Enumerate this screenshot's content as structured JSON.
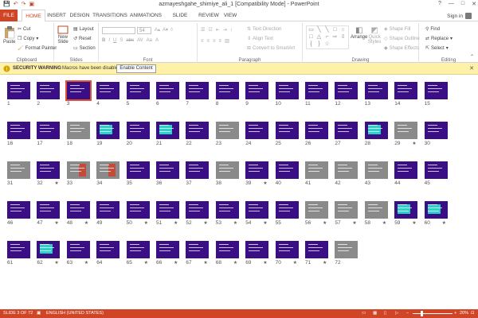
{
  "window": {
    "title": "azmayeshgahe_shimiye_ali_1 [Compatibility Mode] - PowerPoint",
    "controls": [
      "?",
      "—",
      "□",
      "✕"
    ]
  },
  "qat": [
    "💾",
    "↶",
    "↷",
    "▣"
  ],
  "tabs": [
    "FILE",
    "HOME",
    "INSERT",
    "DESIGN",
    "TRANSITIONS",
    "ANIMATIONS",
    "SLIDE SHOW",
    "REVIEW",
    "VIEW"
  ],
  "active_tab": "HOME",
  "signin": "Sign in",
  "ribbon": {
    "clipboard": {
      "label": "Clipboard",
      "paste": "Paste",
      "cut": "Cut",
      "copy": "Copy",
      "format_painter": "Format Painter"
    },
    "slides": {
      "label": "Slides",
      "new_slide": "New",
      "new_slide2": "Slide",
      "layout": "Layout",
      "reset": "Reset",
      "section": "Section"
    },
    "font": {
      "label": "Font",
      "size": "54"
    },
    "paragraph": {
      "label": "Paragraph",
      "text_direction": "Text Direction",
      "align_text": "Align Text",
      "convert": "Convert to SmartArt"
    },
    "drawing": {
      "label": "Drawing",
      "arrange": "Arrange",
      "quick_styles": "Quick",
      "quick_styles2": "Styles",
      "shape_fill": "Shape Fill",
      "shape_outline": "Shape Outline",
      "shape_effects": "Shape Effects"
    },
    "editing": {
      "label": "Editing",
      "find": "Find",
      "replace": "Replace",
      "select": "Select"
    }
  },
  "security_bar": {
    "title": "SECURITY WARNING",
    "message": "Macros have been disabled.",
    "button": "Enable Content"
  },
  "slides": {
    "selected": 3,
    "starred": [
      29,
      32,
      39,
      47,
      48,
      50,
      51,
      52,
      53,
      54,
      56,
      57,
      58,
      59,
      60,
      62,
      63,
      65,
      66,
      67,
      68,
      69,
      70,
      71
    ],
    "variant_cyan": [
      19,
      21,
      28,
      59,
      60,
      62
    ],
    "variant_gray": [
      18,
      23,
      29,
      31,
      33,
      34,
      38,
      41,
      42,
      43,
      56,
      57,
      58,
      72
    ],
    "variant_red": [
      33,
      34
    ]
  },
  "status": {
    "slide_info": "SLIDE 3 OF 72",
    "language": "ENGLISH (UNITED STATES)",
    "zoom": "20%",
    "zoom_fraction": 0.2
  },
  "colors": {
    "accent": "#d04525",
    "slide_bg": "#3a0f86",
    "warning": "#fff1a8"
  }
}
